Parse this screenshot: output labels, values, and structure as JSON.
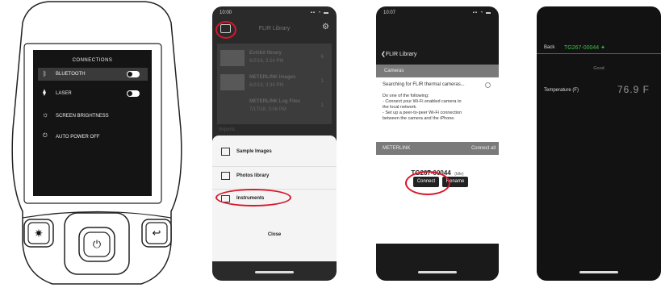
{
  "device": {
    "menu_title": "CONNECTIONS",
    "menu_items": [
      {
        "label": "BLUETOOTH",
        "icon": "bluetooth-icon",
        "toggle": true
      },
      {
        "label": "LASER",
        "icon": "laser-icon",
        "toggle": true
      },
      {
        "label": "SCREEN BRIGHTNESS",
        "icon": "brightness-icon",
        "toggle": false
      },
      {
        "label": "AUTO POWER OFF",
        "icon": "power-icon",
        "toggle": false
      }
    ]
  },
  "phone1": {
    "time": "10:00",
    "title": "FLIR Library",
    "library_items": [
      {
        "name": "Exhibit library",
        "date": "6/2/18, 3:24 PM",
        "count": "6"
      },
      {
        "name": "METERLINK Images",
        "date": "6/2/18, 3:34 PM",
        "count": "1"
      },
      {
        "name": "METERLINK Log Files",
        "date": "7/17/18, 3:06 PM",
        "count": "1"
      }
    ],
    "section_label": "Imports",
    "sheet_items": [
      {
        "label": "Sample Images",
        "icon": "images-icon"
      },
      {
        "label": "Photos library",
        "icon": "photo-icon"
      },
      {
        "label": "Instruments",
        "icon": "camera-icon"
      }
    ],
    "close_label": "Close"
  },
  "phone2": {
    "time": "10:07",
    "back_label": "FLIR Library",
    "section_cameras": "Cameras",
    "search_text": "Searching for FLIR thermal cameras...",
    "help_lines": [
      "Do one of the following:",
      "- Connect your Wi-Fi enabled camera to",
      "the local network.",
      "- Set up a peer-to-peer Wi-Fi connection",
      "between the camera and the iPhone."
    ],
    "section_meterlink": "METERLINK",
    "connect_all": "Connect all",
    "device_id": "TG267-00044",
    "device_status": "(Idle)",
    "connect_label": "Connect",
    "rename_label": "Rename"
  },
  "phone3": {
    "back_label": "Back",
    "device_title": "TG267-00044",
    "status": "Good",
    "temp_label": "Temperature (F)",
    "temp_value": "76.9 F"
  },
  "colors": {
    "accent": "#d8172a",
    "green": "#3bbf4a"
  }
}
